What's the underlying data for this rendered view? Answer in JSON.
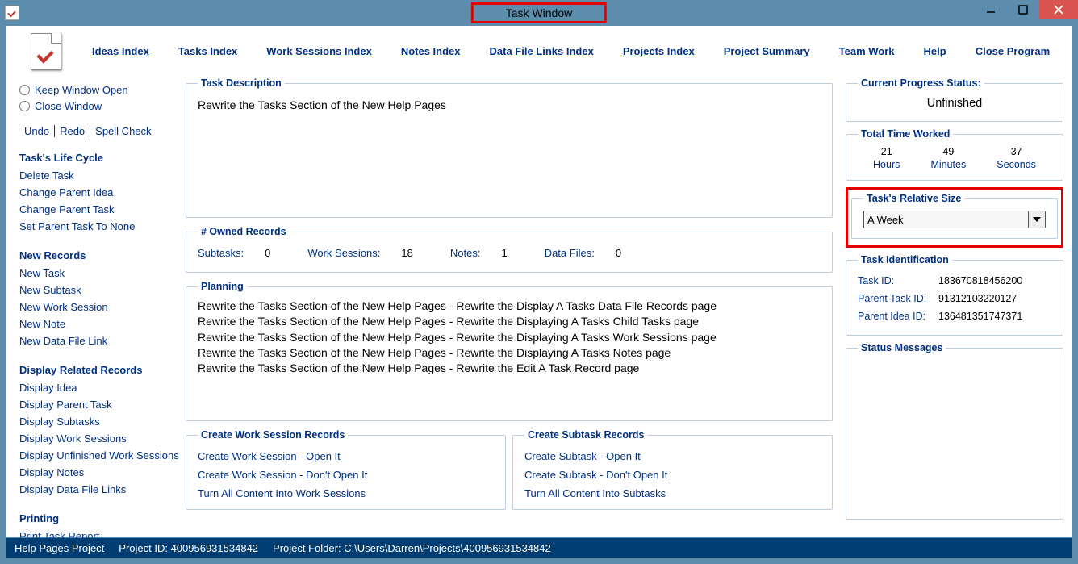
{
  "window": {
    "title": "Task Window"
  },
  "menu": {
    "ideas": "Ideas Index",
    "tasks": "Tasks Index",
    "work_sessions": "Work Sessions Index",
    "notes": "Notes Index",
    "data_links": "Data File Links Index",
    "projects": "Projects Index",
    "summary": "Project Summary",
    "team": "Team Work",
    "help": "Help",
    "close": "Close Program"
  },
  "sidebar": {
    "radio_keep": "Keep Window Open",
    "radio_close": "Close Window",
    "undo": "Undo",
    "redo": "Redo",
    "spell": "Spell Check",
    "sec_life": "Task's Life Cycle",
    "life": {
      "delete": "Delete Task",
      "change_idea": "Change Parent Idea",
      "change_task": "Change Parent Task",
      "set_none": "Set Parent Task To None"
    },
    "sec_new": "New Records",
    "newr": {
      "task": "New Task",
      "subtask": "New Subtask",
      "ws": "New Work Session",
      "note": "New Note",
      "dfl": "New Data File Link"
    },
    "sec_disp": "Display Related Records",
    "disp": {
      "idea": "Display Idea",
      "ptask": "Display Parent Task",
      "subtasks": "Display Subtasks",
      "ws": "Display Work Sessions",
      "uws": "Display Unfinished Work Sessions",
      "notes": "Display Notes",
      "dfl": "Display Data File Links"
    },
    "sec_print": "Printing",
    "print": {
      "report": "Print Task Report"
    }
  },
  "main": {
    "desc_legend": "Task Description",
    "desc_text": "Rewrite the Tasks Section of the New Help Pages",
    "owned_legend": "# Owned Records",
    "owned": {
      "subtasks_label": "Subtasks:",
      "subtasks_val": "0",
      "ws_label": "Work Sessions:",
      "ws_val": "18",
      "notes_label": "Notes:",
      "notes_val": "1",
      "df_label": "Data Files:",
      "df_val": "0"
    },
    "planning_legend": "Planning",
    "planning_lines": [
      "Rewrite the Tasks Section of the New Help Pages - Rewrite the Display A Tasks Data File Records page",
      "Rewrite the Tasks Section of the New Help Pages - Rewrite the Displaying A Tasks Child Tasks page",
      "Rewrite the Tasks Section of the New Help Pages - Rewrite the Displaying A Tasks Work Sessions page",
      "Rewrite the Tasks Section of the New Help Pages - Rewrite the Displaying A Tasks Notes page",
      "Rewrite the Tasks Section of the New Help Pages - Rewrite the Edit A Task Record page"
    ],
    "create_ws_legend": "Create Work Session Records",
    "create_ws": {
      "open": "Create Work Session - Open It",
      "dont": "Create Work Session - Don't Open It",
      "turn": "Turn All Content Into Work Sessions"
    },
    "create_sub_legend": "Create Subtask Records",
    "create_sub": {
      "open": "Create Subtask - Open It",
      "dont": "Create Subtask - Don't Open It",
      "turn": "Turn All Content Into Subtasks"
    }
  },
  "right": {
    "progress_legend": "Current Progress Status:",
    "progress_val": "Unfinished",
    "time_legend": "Total Time Worked",
    "time": {
      "h": "21",
      "h_label": "Hours",
      "m": "49",
      "m_label": "Minutes",
      "s": "37",
      "s_label": "Seconds"
    },
    "relsize_legend": "Task's Relative Size",
    "relsize_val": "A Week",
    "ident_legend": "Task Identification",
    "ident": {
      "task_lbl": "Task ID:",
      "task_val": "183670818456200",
      "ptask_lbl": "Parent Task ID:",
      "ptask_val": "91312103220127",
      "pidea_lbl": "Parent Idea ID:",
      "pidea_val": "136481351747371"
    },
    "status_legend": "Status Messages"
  },
  "statusbar": {
    "proj": "Help Pages Project",
    "id_label": "Project ID:  400956931534842",
    "folder": "Project Folder: C:\\Users\\Darren\\Projects\\400956931534842"
  }
}
